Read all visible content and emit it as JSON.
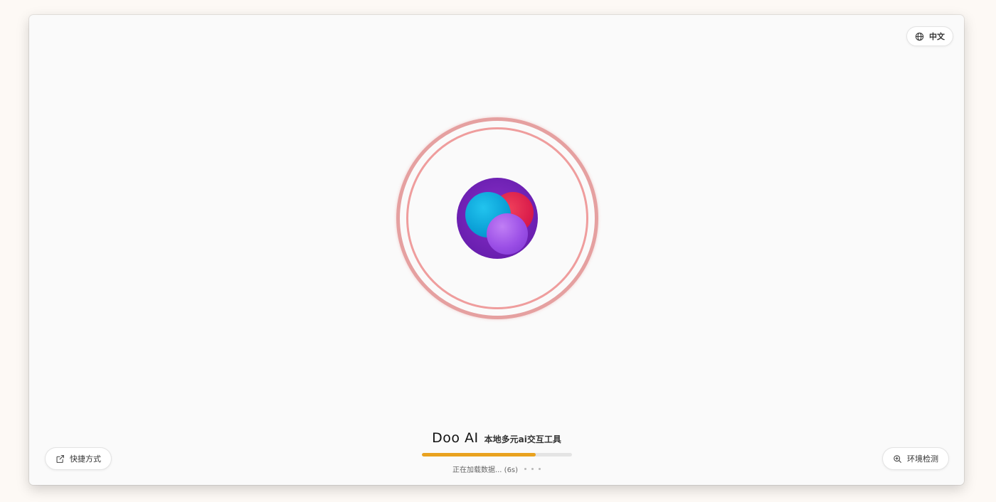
{
  "header": {
    "language_label": "中文",
    "language_icon": "globe-icon"
  },
  "splash": {
    "app_name": "Doo AI",
    "tagline": "本地多元ai交互工具",
    "status_text": "正在加载数据... (6s)",
    "progress_percent": 76,
    "colors": {
      "progress_fill": "#e9a21f",
      "progress_track": "#e4e4e4",
      "ring": "#ec8c8c",
      "orb_purple": "#6a1fb0",
      "orb_blue": "#0a9fd6",
      "orb_red": "#d81a4a",
      "orb_violet": "#9b4fe6"
    }
  },
  "footer": {
    "shortcut_label": "快捷方式",
    "shortcut_icon": "external-link-icon",
    "env_check_label": "环境检测",
    "env_check_icon": "zoom-search-icon"
  }
}
